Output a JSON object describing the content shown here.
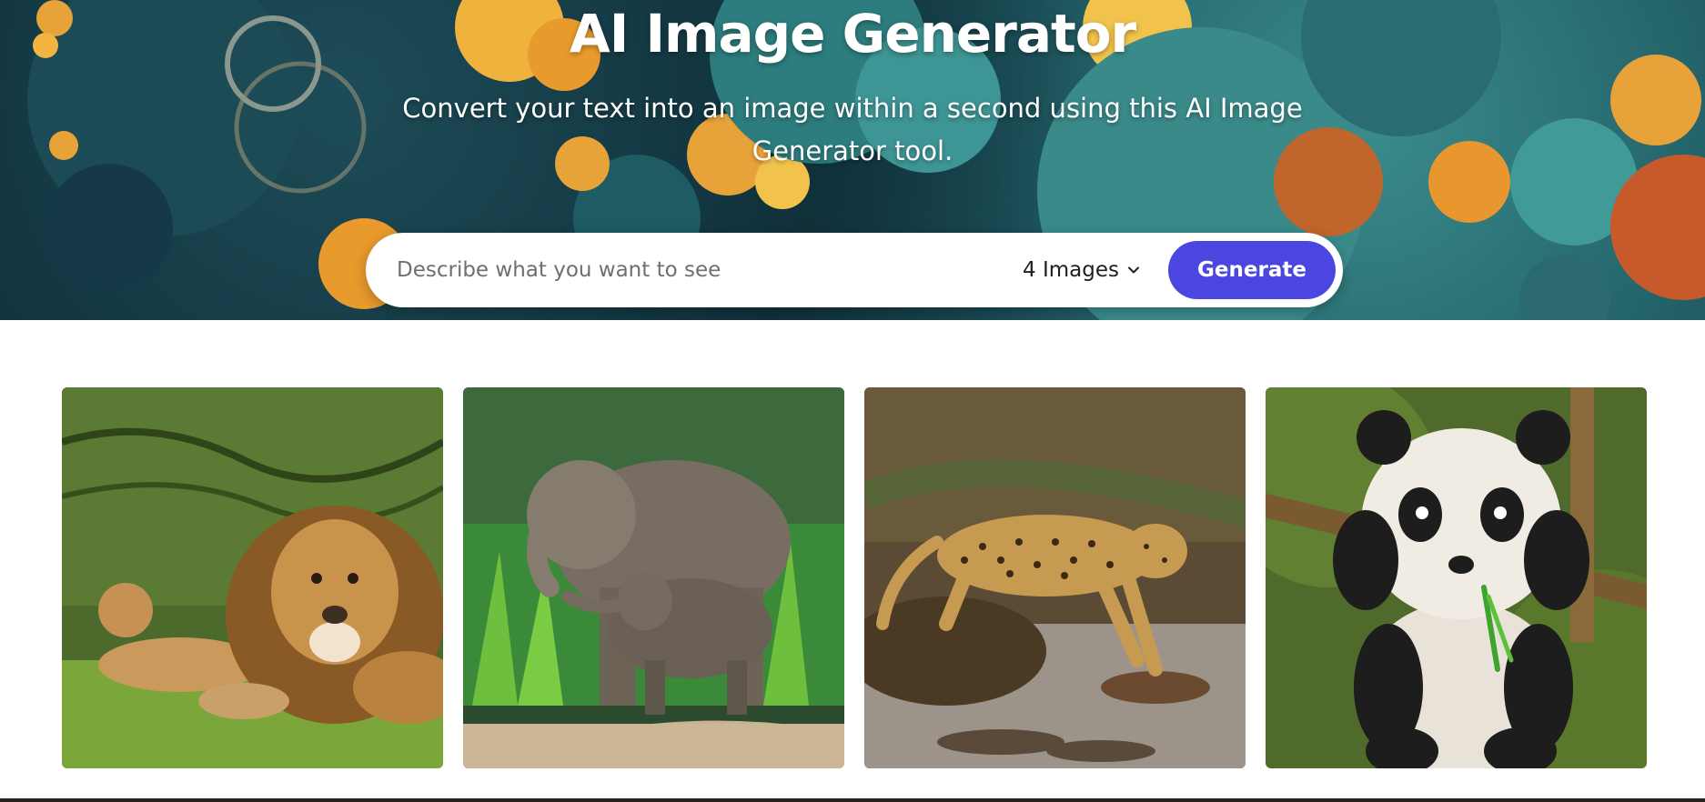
{
  "hero": {
    "title": "AI Image Generator",
    "subtitle": "Convert your text into an image within a second using this AI Image Generator tool."
  },
  "search": {
    "placeholder": "Describe what you want to see",
    "value": ""
  },
  "image_count": {
    "selected": "4 Images"
  },
  "generate": {
    "label": "Generate"
  },
  "gallery": [
    {
      "subject": "lion-and-cub-image"
    },
    {
      "subject": "elephant-and-calf-image"
    },
    {
      "subject": "leopard-image"
    },
    {
      "subject": "panda-cub-image"
    }
  ],
  "colors": {
    "accent": "#4b46e0",
    "hero_teal": "#1f5a63",
    "hero_orange": "#e8a23a"
  },
  "icons": {
    "dropdown": "chevron-down-icon"
  }
}
